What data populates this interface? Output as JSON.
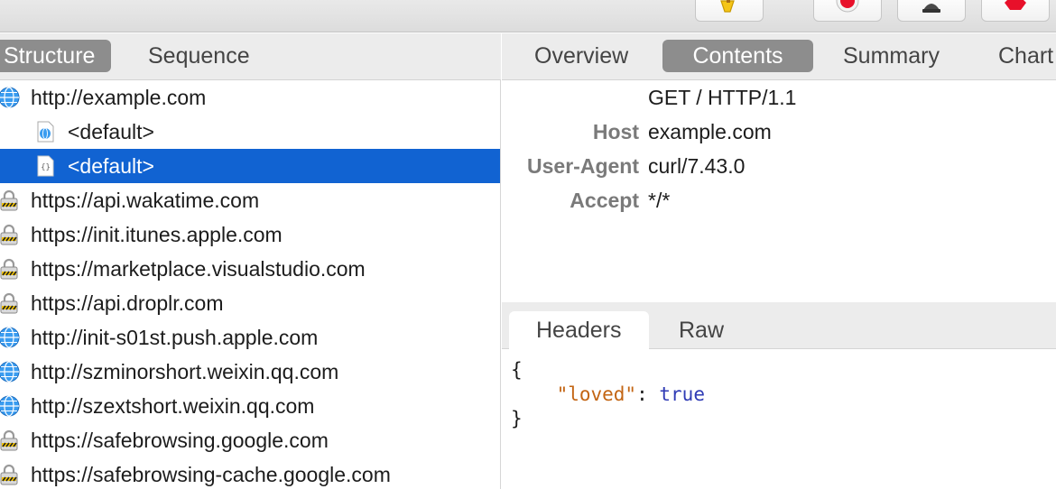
{
  "colors": {
    "selection": "#1163d2",
    "segment_active": "#8d8d8d",
    "header_key": "#7a7a7a",
    "json_string": "#c36513",
    "json_literal": "#2f3bb5",
    "record_red": "#e8102a"
  },
  "toolbar": {
    "buttons": [
      {
        "icon": "broom-icon"
      },
      {
        "icon": "record-icon"
      },
      {
        "icon": "throttle-icon"
      },
      {
        "icon": "stop-icon"
      }
    ]
  },
  "sidebar": {
    "view_modes": [
      {
        "label": "Structure",
        "active": true
      },
      {
        "label": "Sequence",
        "active": false
      }
    ],
    "tree": [
      {
        "label": "http://example.com",
        "icon": "globe-icon",
        "level": 0
      },
      {
        "label": "<default>",
        "icon": "web-request-icon",
        "level": 1
      },
      {
        "label": "<default>",
        "icon": "json-doc-icon",
        "level": 1,
        "selected": true
      },
      {
        "label": "https://api.wakatime.com",
        "icon": "lock-icon",
        "level": 0
      },
      {
        "label": "https://init.itunes.apple.com",
        "icon": "lock-icon",
        "level": 0
      },
      {
        "label": "https://marketplace.visualstudio.com",
        "icon": "lock-icon",
        "level": 0
      },
      {
        "label": "https://api.droplr.com",
        "icon": "lock-icon",
        "level": 0
      },
      {
        "label": "http://init-s01st.push.apple.com",
        "icon": "globe-icon",
        "level": 0
      },
      {
        "label": "http://szminorshort.weixin.qq.com",
        "icon": "globe-icon",
        "level": 0
      },
      {
        "label": "http://szextshort.weixin.qq.com",
        "icon": "globe-icon",
        "level": 0
      },
      {
        "label": "https://safebrowsing.google.com",
        "icon": "lock-icon",
        "level": 0
      },
      {
        "label": "https://safebrowsing-cache.google.com",
        "icon": "lock-icon",
        "level": 0
      }
    ]
  },
  "detail": {
    "tabs": [
      {
        "label": "Overview",
        "active": false
      },
      {
        "label": "Contents",
        "active": true
      },
      {
        "label": "Summary",
        "active": false
      },
      {
        "label": "Chart",
        "active": false
      }
    ],
    "request_line": "GET / HTTP/1.1",
    "headers": [
      {
        "key": "Host",
        "value": "example.com"
      },
      {
        "key": "User-Agent",
        "value": "curl/7.43.0"
      },
      {
        "key": "Accept",
        "value": "*/*"
      }
    ],
    "subtabs": [
      {
        "label": "Headers",
        "active": true
      },
      {
        "label": "Raw",
        "active": false
      }
    ],
    "body": {
      "open_brace": "{",
      "key": "\"loved\"",
      "colon": ": ",
      "value": "true",
      "close_brace": "}"
    }
  }
}
